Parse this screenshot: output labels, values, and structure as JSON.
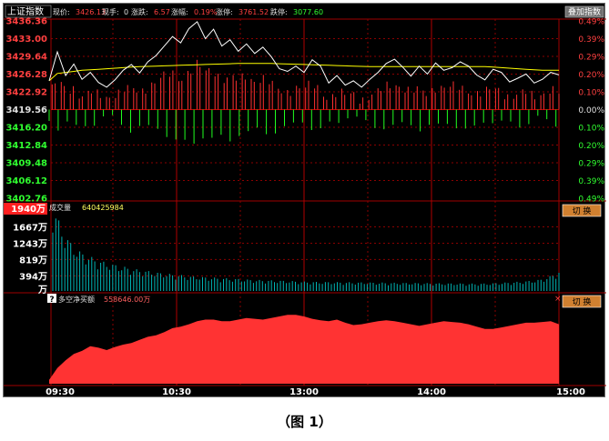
{
  "header": {
    "index_name": "上证指数",
    "items": [
      {
        "label": "现价:",
        "value": "3426.13",
        "color": "#ff4040"
      },
      {
        "label": "现手:",
        "value": "0",
        "color": "#e0e0e0"
      },
      {
        "label": "涨跌:",
        "value": "6.57",
        "color": "#ff4040"
      },
      {
        "label": "涨幅:",
        "value": "0.19%",
        "color": "#ff4040"
      },
      {
        "label": "涨停:",
        "value": "3761.52",
        "color": "#ff4040"
      },
      {
        "label": "跌停:",
        "value": "3077.60",
        "color": "#30ff30"
      }
    ],
    "button": "叠加指数"
  },
  "panels": {
    "volume": {
      "title": "成交量",
      "value": "640425984",
      "max_label": "1940万",
      "button": "切 换"
    },
    "net_buy": {
      "title": "多空净买额",
      "value": "558646.00万",
      "help_icon": "?",
      "button": "切 换"
    }
  },
  "caption": "（图 1）",
  "colors": {
    "up": "#ff3030",
    "down": "#20ff20",
    "grid": "#8b0000",
    "price": "#ffffff",
    "avg": "#ffff00",
    "volume": "#00b4b4",
    "netbuy": "#ff3333"
  },
  "chart_data": [
    {
      "type": "line",
      "title": "上证指数",
      "x_ticks": [
        "09:30",
        "10:30",
        "13:00",
        "14:00",
        "15:00"
      ],
      "y_ticks_left": [
        "3436.36",
        "3433.00",
        "3429.64",
        "3426.28",
        "3422.92",
        "3419.56",
        "3416.20",
        "3412.84",
        "3409.48",
        "3406.12",
        "3402.76"
      ],
      "y_ticks_right": [
        "0.49%",
        "0.39%",
        "0.29%",
        "0.20%",
        "0.10%",
        "0.00%",
        "0.10%",
        "0.20%",
        "0.29%",
        "0.39%",
        "0.49%"
      ],
      "ylim": [
        3402.76,
        3436.36
      ],
      "prev_close": 3419.56,
      "series": [
        {
          "name": "现价",
          "values": [
            3425.0,
            3430.5,
            3426.0,
            3428.2,
            3425.3,
            3426.6,
            3424.7,
            3423.8,
            3425.2,
            3427.0,
            3428.1,
            3426.5,
            3428.6,
            3429.8,
            3431.6,
            3433.4,
            3432.2,
            3434.9,
            3436.2,
            3433.0,
            3434.8,
            3431.6,
            3432.8,
            3430.6,
            3432.0,
            3430.2,
            3431.4,
            3429.6,
            3427.3,
            3426.8,
            3427.8,
            3426.6,
            3429.0,
            3427.8,
            3424.6,
            3426.0,
            3424.2,
            3425.0,
            3423.8,
            3425.3,
            3426.6,
            3428.3,
            3429.1,
            3427.6,
            3425.9,
            3427.8,
            3426.3,
            3428.4,
            3427.0,
            3427.5,
            3428.6,
            3427.8,
            3426.1,
            3425.2,
            3427.2,
            3426.6,
            3424.8,
            3425.5,
            3426.3,
            3424.6,
            3425.3,
            3426.6,
            3426.13
          ]
        },
        {
          "name": "均价",
          "values": [
            3425.0,
            3426.4,
            3426.6,
            3426.8,
            3427.0,
            3427.1,
            3427.2,
            3427.3,
            3427.4,
            3427.5,
            3427.6,
            3427.7,
            3427.75,
            3427.8,
            3427.85,
            3427.9,
            3427.95,
            3428.0,
            3428.05,
            3428.1,
            3428.15,
            3428.2,
            3428.25,
            3428.3,
            3428.3,
            3428.3,
            3428.3,
            3428.3,
            3428.25,
            3428.2,
            3428.15,
            3428.1,
            3428.05,
            3428.0,
            3427.95,
            3427.9,
            3427.85,
            3427.8,
            3427.75,
            3427.7,
            3427.7,
            3427.7,
            3427.7,
            3427.7,
            3427.7,
            3427.7,
            3427.7,
            3427.7,
            3427.7,
            3427.7,
            3427.7,
            3427.7,
            3427.7,
            3427.7,
            3427.6,
            3427.5,
            3427.4,
            3427.3,
            3427.2,
            3427.1,
            3427.0,
            3427.0,
            3427.0
          ]
        }
      ]
    },
    {
      "type": "bar",
      "title": "成交量",
      "y_ticks": [
        "1940万",
        "1667万",
        "1243万",
        "819万",
        "394万",
        "万"
      ],
      "ylim": [
        0,
        1940
      ],
      "unit": "万",
      "values": [
        1900,
        1400,
        1100,
        900,
        800,
        720,
        650,
        600,
        560,
        520,
        480,
        450,
        430,
        400,
        380,
        360,
        340,
        320,
        310,
        300,
        290,
        280,
        270,
        260,
        250,
        240,
        235,
        230,
        225,
        220,
        210,
        205,
        200,
        198,
        196,
        194,
        192,
        190,
        188,
        186,
        184,
        182,
        180,
        178,
        176,
        174,
        172,
        170,
        168,
        166,
        164,
        162,
        160,
        165,
        170,
        180,
        190,
        200,
        215,
        230,
        260,
        330,
        430
      ]
    },
    {
      "type": "area",
      "title": "多空净买额",
      "values": [
        0.05,
        0.2,
        0.3,
        0.38,
        0.42,
        0.48,
        0.46,
        0.43,
        0.47,
        0.5,
        0.52,
        0.56,
        0.6,
        0.62,
        0.66,
        0.71,
        0.73,
        0.76,
        0.8,
        0.82,
        0.82,
        0.8,
        0.8,
        0.82,
        0.84,
        0.83,
        0.82,
        0.84,
        0.86,
        0.88,
        0.88,
        0.86,
        0.83,
        0.81,
        0.8,
        0.82,
        0.78,
        0.75,
        0.76,
        0.78,
        0.8,
        0.81,
        0.8,
        0.78,
        0.76,
        0.74,
        0.76,
        0.78,
        0.8,
        0.79,
        0.78,
        0.76,
        0.73,
        0.7,
        0.7,
        0.72,
        0.74,
        0.76,
        0.78,
        0.78,
        0.79,
        0.8,
        0.76
      ]
    }
  ]
}
